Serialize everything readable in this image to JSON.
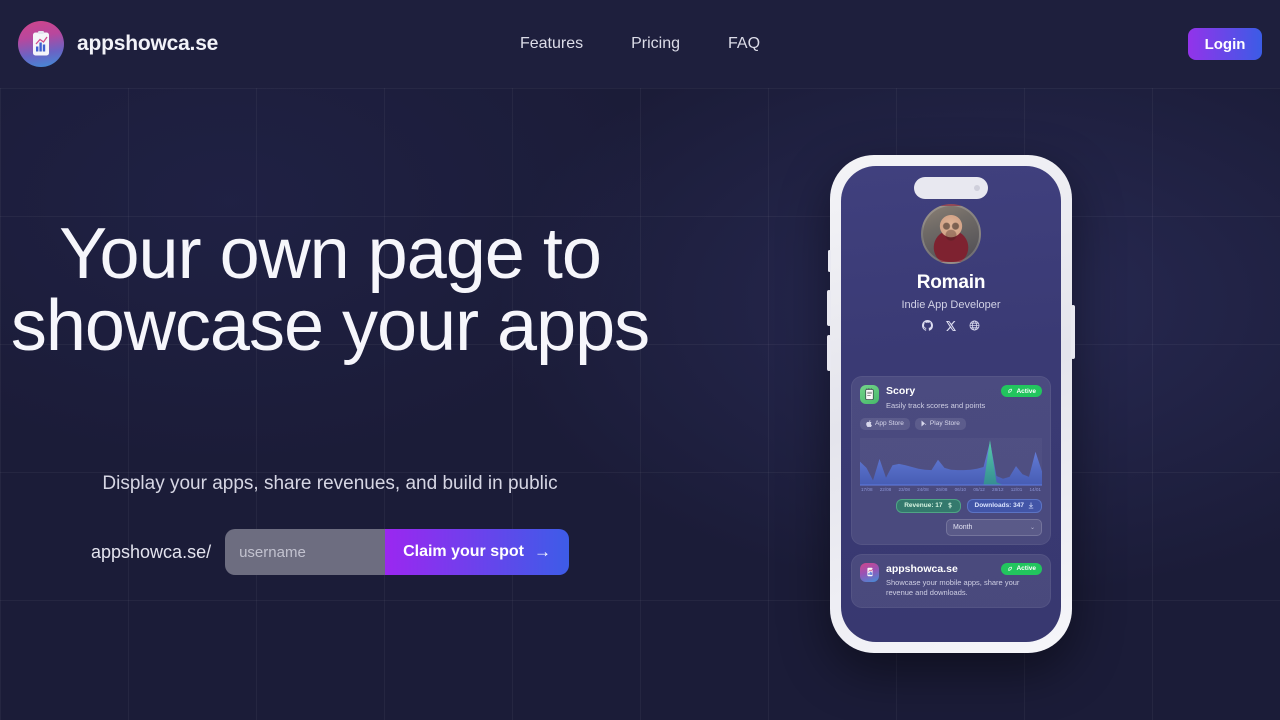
{
  "theme": {
    "page_bg": "#1b1c38",
    "header_bg": "#1e1f3d",
    "accent_purple": "#9333ea",
    "accent_blue": "#3b5ce6",
    "active_green": "#22c55e",
    "text_primary": "#f6f6fb",
    "text_muted": "#d6d6e4"
  },
  "header": {
    "brand_name": "appshowca.se",
    "logo_icon": "phone-chart-icon",
    "nav": [
      {
        "label": "Features"
      },
      {
        "label": "Pricing"
      },
      {
        "label": "FAQ"
      }
    ],
    "login_label": "Login"
  },
  "hero": {
    "title": "Your own page to showcase your apps",
    "subtitle": "Display your apps, share revenues, and build in public",
    "domain_prefix": "appshowca.se/",
    "username_value": "",
    "username_placeholder": "username",
    "claim_label": "Claim your spot",
    "claim_arrow": "→"
  },
  "phone": {
    "profile": {
      "name": "Romain",
      "role": "Indie App Developer",
      "socials": [
        {
          "icon": "github-icon"
        },
        {
          "icon": "x-twitter-icon"
        },
        {
          "icon": "globe-icon"
        }
      ]
    },
    "apps": [
      {
        "icon": "scory-notepad-icon",
        "name": "Scory",
        "description": "Easily track scores and points",
        "status": "Active",
        "status_icon": "rocket-icon",
        "stores": [
          {
            "icon": "apple-icon",
            "label": "App Store"
          },
          {
            "icon": "google-play-icon",
            "label": "Play Store"
          }
        ],
        "stats": {
          "revenue_label": "Revenue: 17",
          "revenue_icon": "dollar-icon",
          "downloads_label": "Downloads: 347",
          "downloads_icon": "download-icon"
        },
        "period": {
          "selected": "Month",
          "chevron": "⌄"
        }
      },
      {
        "icon": "appshowcase-icon",
        "name": "appshowca.se",
        "description": "Showcase your mobile apps, share your revenue and downloads.",
        "status": "Active",
        "status_icon": "rocket-icon",
        "stores": [],
        "stats": null,
        "period": null
      }
    ]
  },
  "chart_data": {
    "type": "area",
    "title": "",
    "xlabel": "",
    "ylabel": "",
    "x": [
      "17/08",
      "22/08",
      "23/08",
      "24/08",
      "26/08",
      "06/10",
      "05/12",
      "28/12",
      "12/01",
      "14/01"
    ],
    "series": [
      {
        "name": "Downloads",
        "color": "#4f6fd8",
        "values": [
          52,
          38,
          10,
          58,
          16,
          44,
          47,
          44,
          40,
          36,
          34,
          33,
          56,
          38,
          34,
          33,
          33,
          34,
          36,
          40,
          96,
          20,
          14,
          18,
          42,
          24,
          18,
          74,
          30
        ]
      },
      {
        "name": "Revenue",
        "color": "#3fbf9a",
        "values": [
          0,
          0,
          0,
          0,
          0,
          0,
          0,
          0,
          0,
          0,
          0,
          0,
          0,
          0,
          0,
          0,
          0,
          0,
          0,
          0,
          100,
          6,
          0,
          0,
          0,
          0,
          0,
          0,
          0
        ]
      }
    ],
    "ylim": [
      0,
      100
    ],
    "grid": false,
    "legend": "none"
  }
}
